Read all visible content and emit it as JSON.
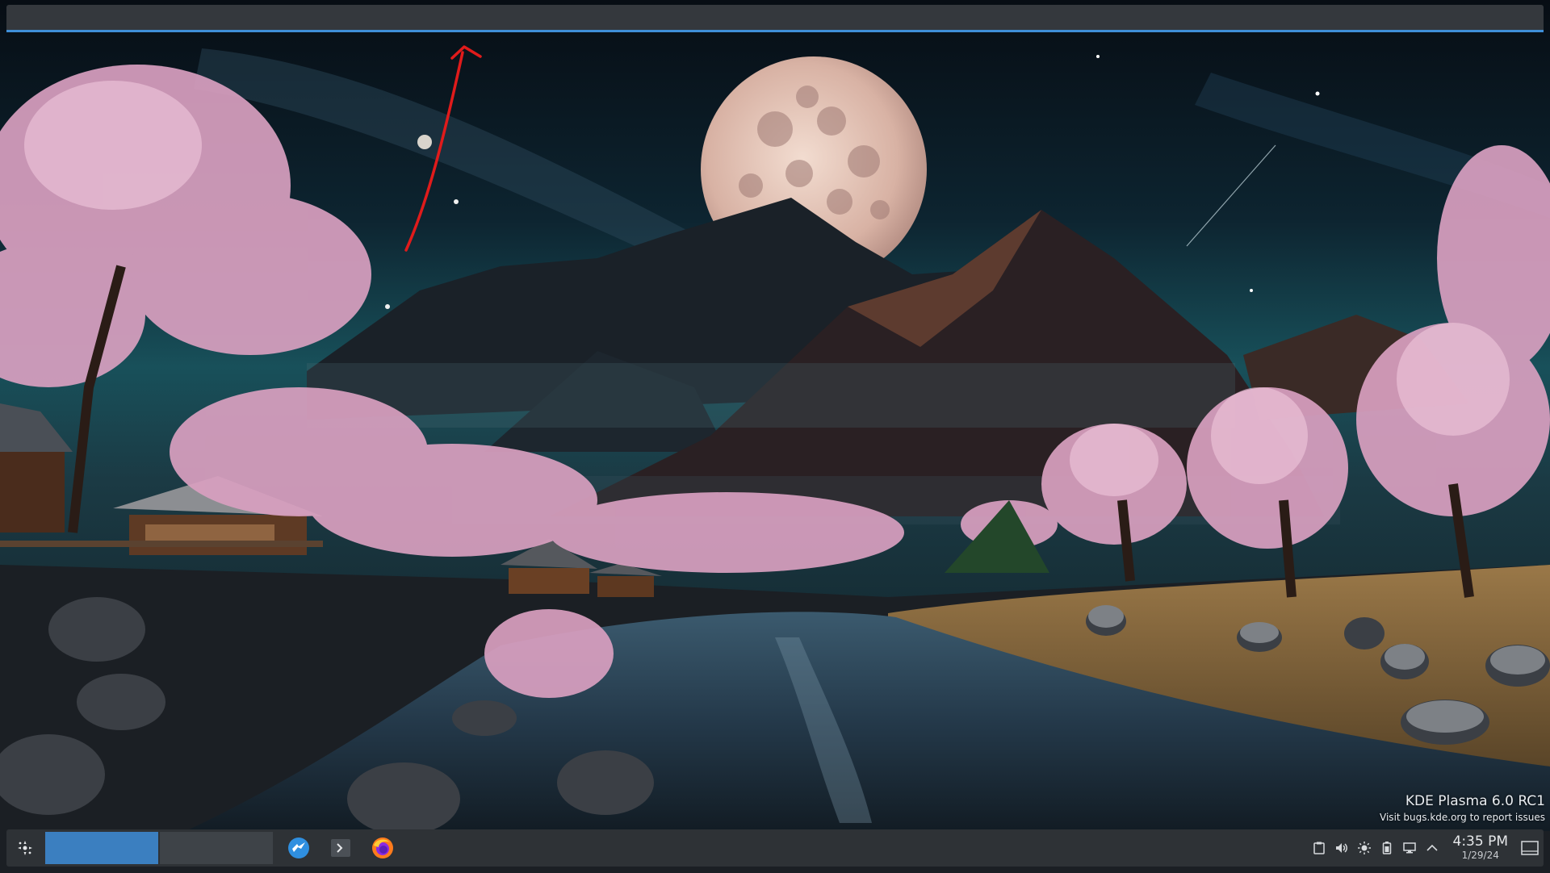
{
  "desktop": {
    "watermark": {
      "title": "KDE Plasma 6.0 RC1",
      "subtitle": "Visit bugs.kde.org to report issues"
    }
  },
  "taskbar": {
    "launcher_icon": "kde-launcher-icon",
    "pager": {
      "desktops": [
        {
          "active": true
        },
        {
          "active": false
        }
      ]
    },
    "tasks": [
      {
        "icon": "plasma-discover-icon"
      },
      {
        "icon": "terminal-icon"
      },
      {
        "icon": "firefox-icon"
      }
    ],
    "tray": [
      "clipboard-icon",
      "volume-icon",
      "brightness-icon",
      "battery-icon",
      "network-icon",
      "expand-tray-icon"
    ],
    "clock": {
      "time": "4:35 PM",
      "date": "1/29/24"
    }
  },
  "colors": {
    "panel": "#34383d",
    "accent": "#3f8fd8",
    "active_desktop": "#3b7fc0",
    "annotation_arrow": "#e01b1b"
  }
}
